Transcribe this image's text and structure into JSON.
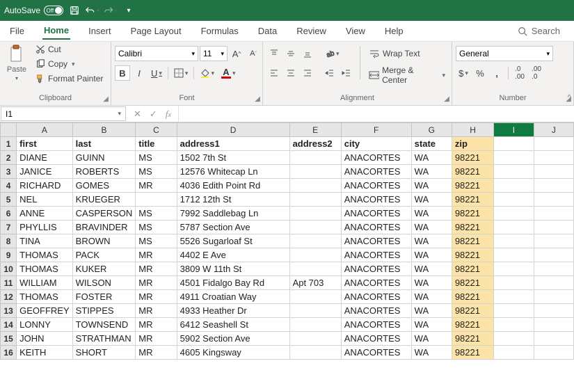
{
  "titlebar": {
    "autosave_label": "AutoSave",
    "autosave_state": "Off"
  },
  "tabs": [
    "File",
    "Home",
    "Insert",
    "Page Layout",
    "Formulas",
    "Data",
    "Review",
    "View",
    "Help"
  ],
  "active_tab": "Home",
  "search_label": "Search",
  "ribbon": {
    "clipboard": {
      "paste": "Paste",
      "cut": "Cut",
      "copy": "Copy",
      "format_painter": "Format Painter",
      "label": "Clipboard"
    },
    "font": {
      "name": "Calibri",
      "size": "11",
      "bold": "B",
      "italic": "I",
      "underline": "U",
      "label": "Font"
    },
    "alignment": {
      "wrap_text": "Wrap Text",
      "merge_center": "Merge & Center",
      "label": "Alignment"
    },
    "number": {
      "format": "General",
      "label": "Number"
    }
  },
  "namebox": "I1",
  "formula": "",
  "columns": [
    "A",
    "B",
    "C",
    "D",
    "E",
    "F",
    "G",
    "H",
    "I",
    "J"
  ],
  "col_classes": [
    "cA",
    "cB",
    "cC",
    "cD",
    "cE",
    "cF",
    "cG",
    "cH",
    "cI",
    "cJ"
  ],
  "selected_col_index": 8,
  "highlight_col_index": 7,
  "rows": [
    {
      "n": 1,
      "c": [
        "first",
        "last",
        "title",
        "address1",
        "address2",
        "city",
        "state",
        "zip",
        "",
        ""
      ],
      "bold": true
    },
    {
      "n": 2,
      "c": [
        "DIANE",
        "GUINN",
        "MS",
        "1502 7th St",
        "",
        "ANACORTES",
        "WA",
        "98221",
        "",
        ""
      ]
    },
    {
      "n": 3,
      "c": [
        "JANICE",
        "ROBERTS",
        "MS",
        "12576 Whitecap Ln",
        "",
        "ANACORTES",
        "WA",
        "98221",
        "",
        ""
      ]
    },
    {
      "n": 4,
      "c": [
        "RICHARD",
        "GOMES",
        "MR",
        "4036 Edith Point Rd",
        "",
        "ANACORTES",
        "WA",
        "98221",
        "",
        ""
      ]
    },
    {
      "n": 5,
      "c": [
        "NEL",
        "KRUEGER",
        "",
        "1712 12th St",
        "",
        "ANACORTES",
        "WA",
        "98221",
        "",
        ""
      ]
    },
    {
      "n": 6,
      "c": [
        "ANNE",
        "CASPERSON",
        "MS",
        "7992 Saddlebag Ln",
        "",
        "ANACORTES",
        "WA",
        "98221",
        "",
        ""
      ]
    },
    {
      "n": 7,
      "c": [
        "PHYLLIS",
        "BRAVINDER",
        "MS",
        "5787 Section Ave",
        "",
        "ANACORTES",
        "WA",
        "98221",
        "",
        ""
      ]
    },
    {
      "n": 8,
      "c": [
        "TINA",
        "BROWN",
        "MS",
        "5526 Sugarloaf St",
        "",
        "ANACORTES",
        "WA",
        "98221",
        "",
        ""
      ]
    },
    {
      "n": 9,
      "c": [
        "THOMAS",
        "PACK",
        "MR",
        "4402 E Ave",
        "",
        "ANACORTES",
        "WA",
        "98221",
        "",
        ""
      ]
    },
    {
      "n": 10,
      "c": [
        "THOMAS",
        "KUKER",
        "MR",
        "3809 W 11th St",
        "",
        "ANACORTES",
        "WA",
        "98221",
        "",
        ""
      ]
    },
    {
      "n": 11,
      "c": [
        "WILLIAM",
        "WILSON",
        "MR",
        "4501 Fidalgo Bay Rd",
        "Apt 703",
        "ANACORTES",
        "WA",
        "98221",
        "",
        ""
      ]
    },
    {
      "n": 12,
      "c": [
        "THOMAS",
        "FOSTER",
        "MR",
        "4911 Croatian Way",
        "",
        "ANACORTES",
        "WA",
        "98221",
        "",
        ""
      ]
    },
    {
      "n": 13,
      "c": [
        "GEOFFREY",
        "STIPPES",
        "MR",
        "4933 Heather Dr",
        "",
        "ANACORTES",
        "WA",
        "98221",
        "",
        ""
      ]
    },
    {
      "n": 14,
      "c": [
        "LONNY",
        "TOWNSEND",
        "MR",
        "6412 Seashell St",
        "",
        "ANACORTES",
        "WA",
        "98221",
        "",
        ""
      ]
    },
    {
      "n": 15,
      "c": [
        "JOHN",
        "STRATHMAN",
        "MR",
        "5902 Section Ave",
        "",
        "ANACORTES",
        "WA",
        "98221",
        "",
        ""
      ]
    },
    {
      "n": 16,
      "c": [
        "KEITH",
        "SHORT",
        "MR",
        "4605 Kingsway",
        "",
        "ANACORTES",
        "WA",
        "98221",
        "",
        ""
      ]
    }
  ]
}
